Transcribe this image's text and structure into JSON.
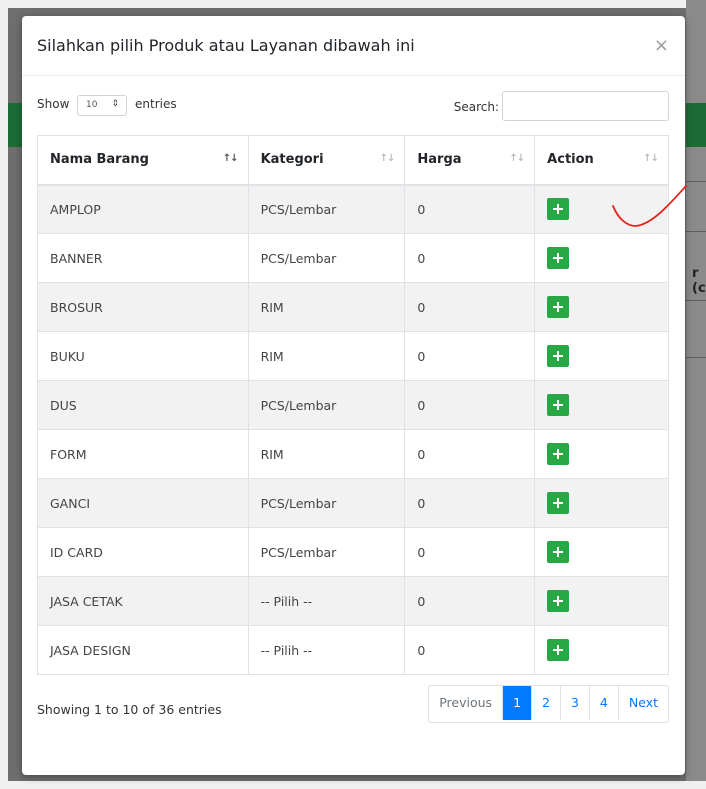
{
  "modal": {
    "title": "Silahkan pilih Produk atau Layanan dibawah ini",
    "close_symbol": "×"
  },
  "controls": {
    "show_label": "Show",
    "page_size": "10",
    "entries_label": "entries",
    "search_label": "Search:",
    "search_value": ""
  },
  "table": {
    "headers": [
      "Nama Barang",
      "Kategori",
      "Harga",
      "Action"
    ],
    "rows": [
      {
        "name": "AMPLOP",
        "category": "PCS/Lembar",
        "price": "0"
      },
      {
        "name": "BANNER",
        "category": "PCS/Lembar",
        "price": "0"
      },
      {
        "name": "BROSUR",
        "category": "RIM",
        "price": "0"
      },
      {
        "name": "BUKU",
        "category": "RIM",
        "price": "0"
      },
      {
        "name": "DUS",
        "category": "PCS/Lembar",
        "price": "0"
      },
      {
        "name": "FORM",
        "category": "RIM",
        "price": "0"
      },
      {
        "name": "GANCI",
        "category": "PCS/Lembar",
        "price": "0"
      },
      {
        "name": "ID CARD",
        "category": "PCS/Lembar",
        "price": "0"
      },
      {
        "name": "JASA CETAK",
        "category": "-- Pilih --",
        "price": "0"
      },
      {
        "name": "JASA DESIGN",
        "category": "-- Pilih --",
        "price": "0"
      }
    ],
    "action_icon": "plus-icon"
  },
  "footer": {
    "info": "Showing 1 to 10 of 36 entries",
    "pagination": {
      "previous": "Previous",
      "pages": [
        "1",
        "2",
        "3",
        "4"
      ],
      "next": "Next"
    }
  },
  "background": {
    "partial_text": "r (c"
  },
  "colors": {
    "action_button": "#28a745",
    "active_page": "#007bff",
    "annotation": "#e8201a"
  }
}
